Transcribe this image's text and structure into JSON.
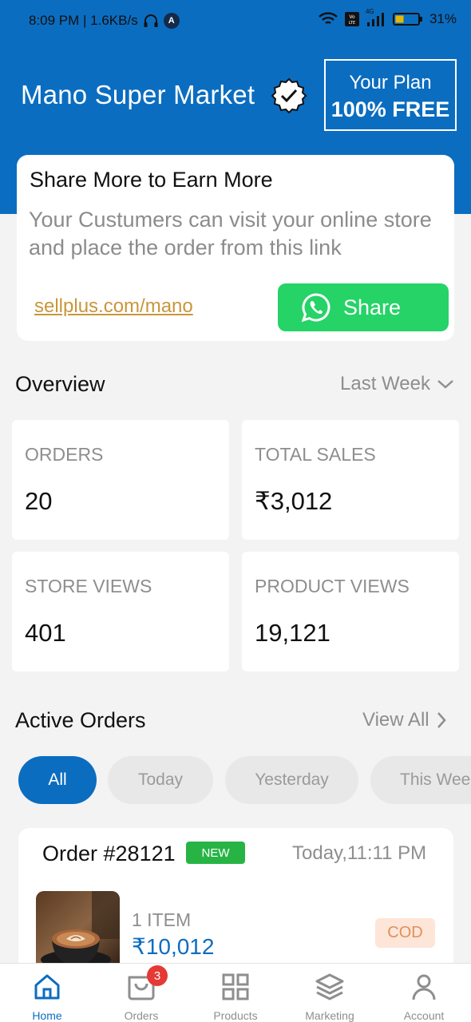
{
  "status_bar": {
    "time_speed": "8:09 PM | 1.6KB/s",
    "app_badge": "A",
    "network": "4G",
    "battery": "31%"
  },
  "header": {
    "store_name": "Mano Super Market",
    "plan_line1": "Your Plan",
    "plan_line2": "100% FREE"
  },
  "share_card": {
    "title": "Share More to Earn More",
    "description": "Your Custumers can visit your online store and place the order from this link",
    "link": "sellplus.com/mano",
    "button_label": "Share"
  },
  "overview": {
    "title": "Overview",
    "filter": "Last Week",
    "stats": [
      {
        "label": "ORDERS",
        "value": "20"
      },
      {
        "label": "TOTAL SALES",
        "value": "₹3,012"
      },
      {
        "label": "STORE VIEWS",
        "value": "401"
      },
      {
        "label": "PRODUCT VIEWS",
        "value": "19,121"
      }
    ]
  },
  "active_orders": {
    "title": "Active Orders",
    "view_all": "View All",
    "filters": [
      "All",
      "Today",
      "Yesterday",
      "This Week"
    ],
    "selected_filter": "All",
    "orders": [
      {
        "id": "Order #28121",
        "badge": "NEW",
        "time": "Today,11:11 PM",
        "items": "1 ITEM",
        "amount": "₹10,012",
        "payment": "COD"
      }
    ]
  },
  "bottom_nav": {
    "items": [
      {
        "label": "Home",
        "icon": "home-icon"
      },
      {
        "label": "Orders",
        "icon": "cart-icon",
        "badge": "3"
      },
      {
        "label": "Products",
        "icon": "grid-icon"
      },
      {
        "label": "Marketing",
        "icon": "layers-icon"
      },
      {
        "label": "Account",
        "icon": "user-icon"
      }
    ],
    "active": "Home"
  },
  "colors": {
    "primary": "#0b6dc0",
    "whatsapp": "#25d366",
    "new_badge": "#28b445",
    "link": "#c9963b",
    "cod_bg": "#fde5d8",
    "notification": "#e53935"
  }
}
